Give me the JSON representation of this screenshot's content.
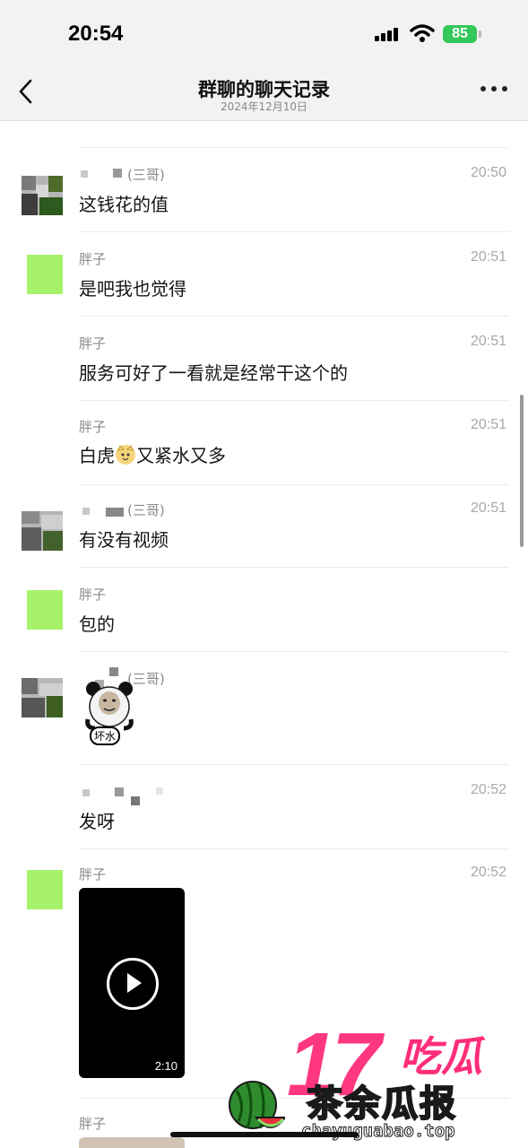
{
  "status_bar": {
    "time": "20:54",
    "battery": "85"
  },
  "nav": {
    "title": "群聊的聊天记录",
    "date": "2024年12月10日"
  },
  "messages": [
    {
      "sender": "(三哥)",
      "time": "20:50",
      "text": "这钱花的值"
    },
    {
      "sender": "胖子",
      "time": "20:51",
      "text": "是吧我也觉得"
    },
    {
      "sender": "胖子",
      "time": "20:51",
      "text": "服务可好了一看就是经常干这个的"
    },
    {
      "sender": "胖子",
      "time": "20:51",
      "text_before": "白虎",
      "text_after": "又紧水又多"
    },
    {
      "sender": "(三哥)",
      "time": "20:51",
      "text": "有没有视频"
    },
    {
      "sender": "胖子",
      "text": "包的"
    },
    {
      "sender": "(三哥)",
      "sticker_caption": "坏水"
    },
    {
      "time": "20:52",
      "text": "发呀"
    },
    {
      "sender": "胖子",
      "time": "20:52",
      "video_duration": "2:10"
    },
    {
      "sender": "胖子"
    }
  ],
  "watermark": {
    "number": "17",
    "chihu": "吃瓜",
    "brand": "茶余瓜报",
    "url": "chayuguabao.top"
  },
  "colors": {
    "avatar_green": "#a6f26a",
    "battery_green": "#34c759",
    "watermark_pink": "#ff2d7a",
    "watermark_yellow": "#ffe600"
  }
}
